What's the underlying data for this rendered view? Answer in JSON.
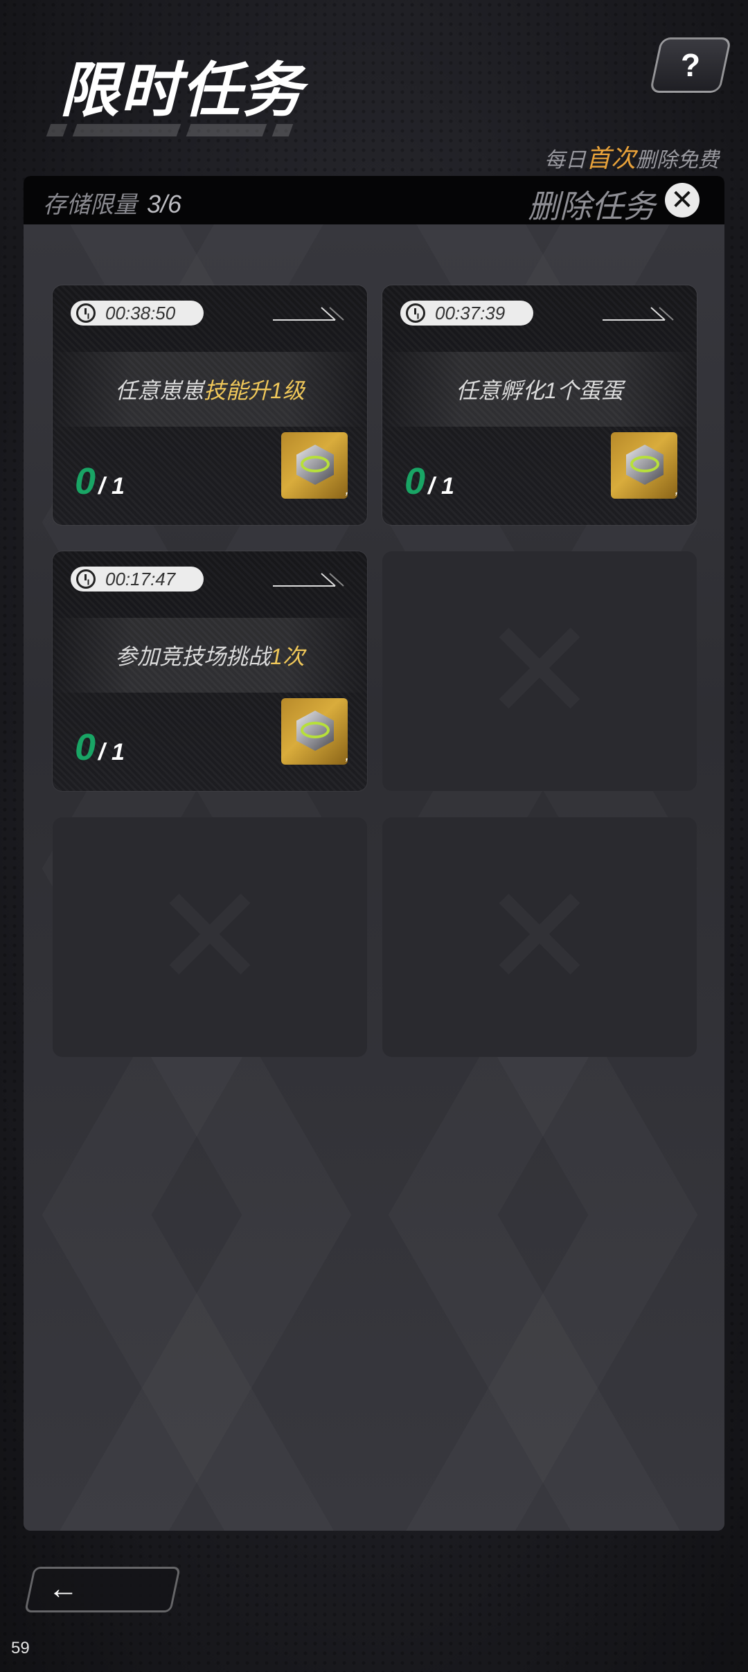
{
  "header": {
    "title": "限时任务",
    "help_label": "?",
    "hint_prefix": "每日",
    "hint_accent": "首次",
    "hint_suffix": "删除免费"
  },
  "panel": {
    "storage_label": "存储限量",
    "storage_value": "3/6",
    "delete_label": "删除任务",
    "close_symbol": "✕"
  },
  "tasks": [
    {
      "timer": "00:38:50",
      "text_before": "任意崽崽",
      "text_highlight": "技能升1级",
      "text_after": "",
      "current": "0",
      "total": "/ 1",
      "reward_count": ","
    },
    {
      "timer": "00:37:39",
      "text_before": "任意孵化1个蛋蛋",
      "text_highlight": "",
      "text_after": "",
      "current": "0",
      "total": "/ 1",
      "reward_count": ","
    },
    {
      "timer": "00:17:47",
      "text_before": "参加竞技场挑战",
      "text_highlight": "1次",
      "text_after": "",
      "current": "0",
      "total": "/ 1",
      "reward_count": ","
    }
  ],
  "footer": {
    "back_symbol": "←",
    "fps": "59"
  },
  "colors": {
    "accent_orange": "#e8a23a",
    "highlight_yellow": "#f0c85a",
    "progress_green": "#19a565"
  }
}
